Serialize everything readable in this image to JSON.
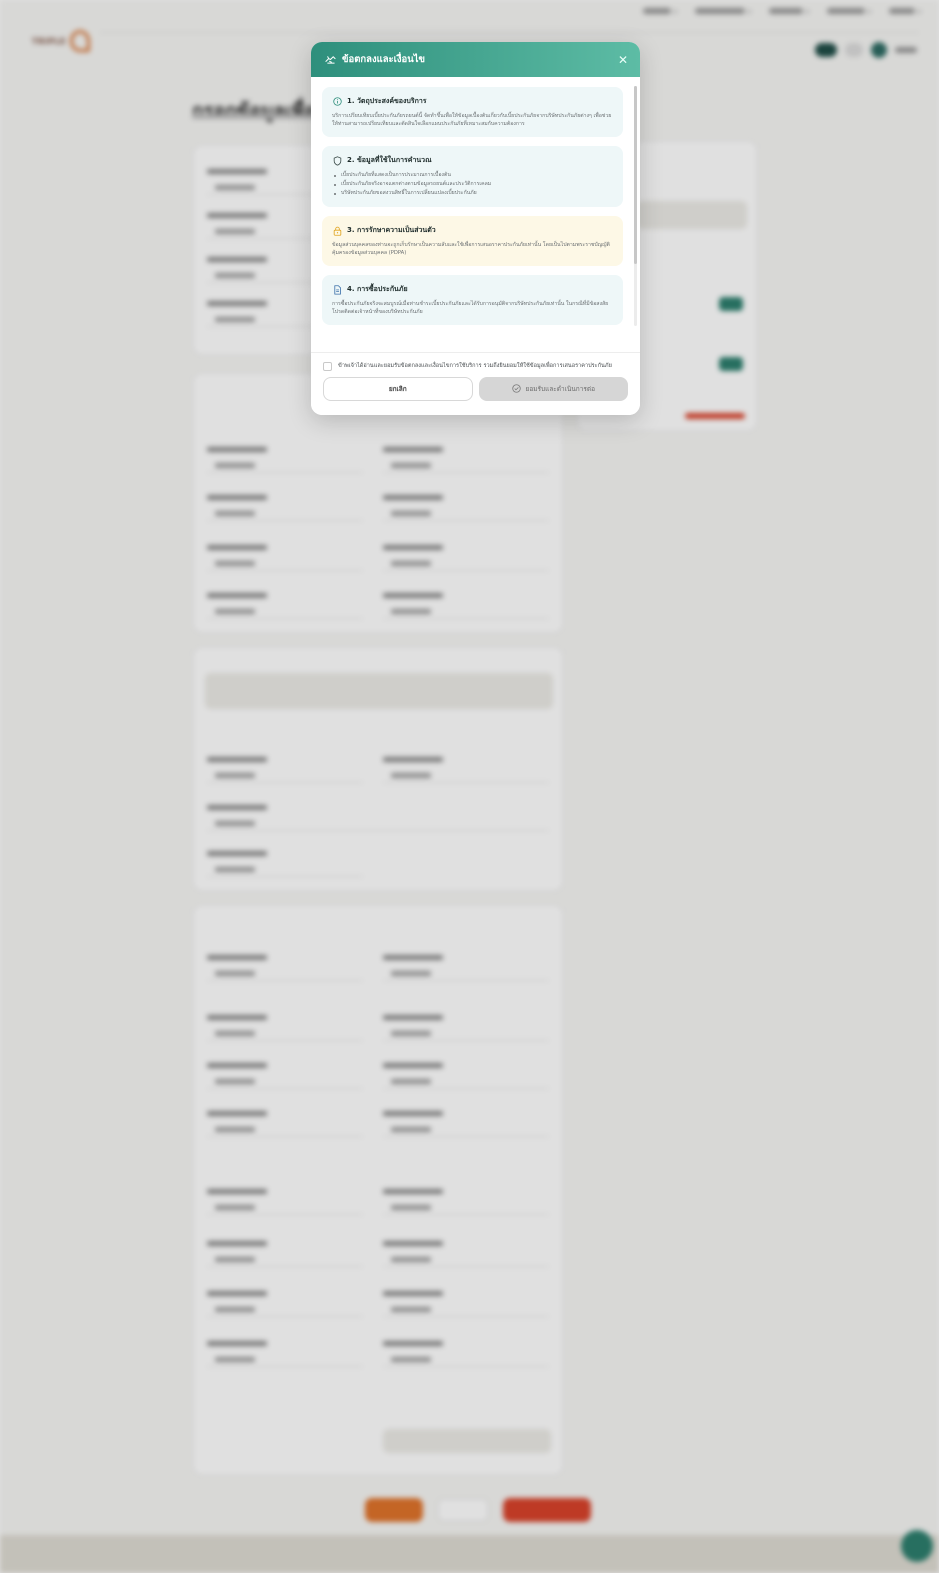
{
  "colors": {
    "modal_header_start": "#2e8f7c",
    "modal_header_end": "#5dbca5",
    "section_teal_bg": "#eef7f8",
    "section_yellow_bg": "#fdf8e6",
    "lock_icon": "#e0a21a",
    "accept_disabled": "#d6d6d6"
  },
  "modal": {
    "title": "ข้อตกลงและเงื่อนไข",
    "title_icon": "handshake-icon",
    "close_icon": "close-icon",
    "sections": [
      {
        "icon": "info-icon",
        "title": "1. วัตถุประสงค์ของบริการ",
        "text": "บริการเปรียบเทียบเบี้ยประกันภัยรถยนต์นี้ จัดทำขึ้นเพื่อให้ข้อมูลเบื้องต้นเกี่ยวกับเบี้ยประกันภัยจากบริษัทประกันภัยต่างๆ เพื่อช่วยให้ท่านสามารถเปรียบเทียบและตัดสินใจเลือกแผนประกันภัยที่เหมาะสมกับความต้องการ"
      },
      {
        "icon": "shield-icon",
        "title": "2. ข้อมูลที่ใช้ในการคำนวณ",
        "items": [
          "เบี้ยประกันภัยที่แสดงเป็นการประมาณการเบื้องต้น",
          "เบี้ยประกันภัยจริงอาจแตกต่างตามข้อมูลรถยนต์และประวัติการเคลม",
          "บริษัทประกันภัยขอสงวนสิทธิ์ในการเปลี่ยนแปลงเบี้ยประกันภัย"
        ]
      },
      {
        "icon": "lock-icon",
        "title": "3. การรักษาความเป็นส่วนตัว",
        "text": "ข้อมูลส่วนบุคคลของท่านจะถูกเก็บรักษาเป็นความลับและใช้เพื่อการเสนอราคาประกันภัยเท่านั้น โดยเป็นไปตามพระราชบัญญัติคุ้มครองข้อมูลส่วนบุคคล (PDPA)"
      },
      {
        "icon": "document-icon",
        "title": "4. การซื้อประกันภัย",
        "text": "การซื้อประกันภัยจริงจะสมบูรณ์เมื่อท่านชำระเบี้ยประกันภัยและได้รับการอนุมัติจากบริษัทประกันภัยเท่านั้น ในกรณีที่มีข้อสงสัยโปรดติดต่อเจ้าหน้าที่ของบริษัทประกันภัย"
      }
    ],
    "agree_text": "ข้าพเจ้าได้อ่านและยอมรับข้อตกลงและเงื่อนไขการใช้บริการ รวมถึงยินยอมให้ใช้ข้อมูลเพื่อการเสนอราคาประกันภัย",
    "cancel_label": "ยกเลิก",
    "accept_label": "ยอมรับและดำเนินการต่อ",
    "accept_icon": "check-circle-icon"
  },
  "background": {
    "page_title": "กรอกข้อมูลเพื่อคำ",
    "footer_icon": "chat-icon"
  }
}
